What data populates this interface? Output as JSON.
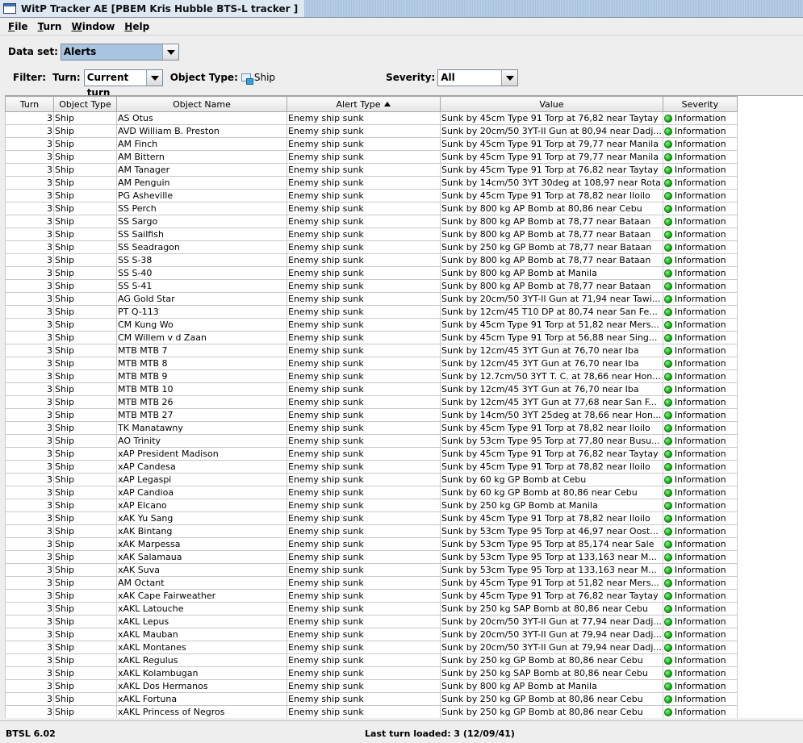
{
  "window": {
    "title": "WitP Tracker AE [PBEM Kris Hubble BTS-L  tracker ]"
  },
  "menu": [
    "File",
    "Turn",
    "Window",
    "Help"
  ],
  "dataset": {
    "label": "Data set:",
    "value": "Alerts"
  },
  "filter": {
    "label": "Filter:",
    "turn_label": "Turn:",
    "turn_value": "Current turn",
    "object_type_label": "Object Type:",
    "object_type_value": "Ship",
    "severity_label": "Severity:",
    "severity_value": "All"
  },
  "table": {
    "columns": [
      "Turn",
      "Object Type",
      "Object Name",
      "Alert Type",
      "Value",
      "Severity"
    ],
    "rows": [
      [
        "3",
        "Ship",
        "AS Otus",
        "Enemy ship sunk",
        "Sunk by 45cm Type 91 Torp at 76,82 near Taytay",
        "Information"
      ],
      [
        "3",
        "Ship",
        "AVD William B. Preston",
        "Enemy ship sunk",
        "Sunk by 20cm/50 3YT-II Gun at 80,94 near Dadj...",
        "Information"
      ],
      [
        "3",
        "Ship",
        "AM Finch",
        "Enemy ship sunk",
        "Sunk by 45cm Type 91 Torp at 79,77 near Manila",
        "Information"
      ],
      [
        "3",
        "Ship",
        "AM Bittern",
        "Enemy ship sunk",
        "Sunk by 45cm Type 91 Torp at 79,77 near Manila",
        "Information"
      ],
      [
        "3",
        "Ship",
        "AM Tanager",
        "Enemy ship sunk",
        "Sunk by 45cm Type 91 Torp at 76,82 near Taytay",
        "Information"
      ],
      [
        "3",
        "Ship",
        "AM Penguin",
        "Enemy ship sunk",
        "Sunk by 14cm/50 3YT 30deg at 108,97 near Rota",
        "Information"
      ],
      [
        "3",
        "Ship",
        "PG Asheville",
        "Enemy ship sunk",
        "Sunk by 45cm Type 91 Torp at 78,82 near Iloilo",
        "Information"
      ],
      [
        "3",
        "Ship",
        "SS Perch",
        "Enemy ship sunk",
        "Sunk by 800 kg AP Bomb at 80,86 near Cebu",
        "Information"
      ],
      [
        "3",
        "Ship",
        "SS Sargo",
        "Enemy ship sunk",
        "Sunk by 800 kg AP Bomb at 78,77 near Bataan",
        "Information"
      ],
      [
        "3",
        "Ship",
        "SS Sailfish",
        "Enemy ship sunk",
        "Sunk by 800 kg AP Bomb at 78,77 near Bataan",
        "Information"
      ],
      [
        "3",
        "Ship",
        "SS Seadragon",
        "Enemy ship sunk",
        "Sunk by 250 kg GP Bomb at 78,77 near Bataan",
        "Information"
      ],
      [
        "3",
        "Ship",
        "SS S-38",
        "Enemy ship sunk",
        "Sunk by 800 kg AP Bomb at 78,77 near Bataan",
        "Information"
      ],
      [
        "3",
        "Ship",
        "SS S-40",
        "Enemy ship sunk",
        "Sunk by 800 kg AP Bomb at Manila",
        "Information"
      ],
      [
        "3",
        "Ship",
        "SS S-41",
        "Enemy ship sunk",
        "Sunk by 800 kg AP Bomb at 78,77 near Bataan",
        "Information"
      ],
      [
        "3",
        "Ship",
        "AG Gold Star",
        "Enemy ship sunk",
        "Sunk by 20cm/50 3YT-II Gun at 71,94 near Tawi...",
        "Information"
      ],
      [
        "3",
        "Ship",
        "PT Q-113",
        "Enemy ship sunk",
        "Sunk by 12cm/45 T10 DP at 80,74 near San Fe...",
        "Information"
      ],
      [
        "3",
        "Ship",
        "CM Kung Wo",
        "Enemy ship sunk",
        "Sunk by 45cm Type 91 Torp at 51,82 near Mers...",
        "Information"
      ],
      [
        "3",
        "Ship",
        "CM Willem v d Zaan",
        "Enemy ship sunk",
        "Sunk by 45cm Type 91 Torp at 56,88 near Sing...",
        "Information"
      ],
      [
        "3",
        "Ship",
        "MTB MTB 7",
        "Enemy ship sunk",
        "Sunk by 12cm/45 3YT Gun at 76,70 near Iba",
        "Information"
      ],
      [
        "3",
        "Ship",
        "MTB MTB 8",
        "Enemy ship sunk",
        "Sunk by 12cm/45 3YT Gun at 76,70 near Iba",
        "Information"
      ],
      [
        "3",
        "Ship",
        "MTB MTB 9",
        "Enemy ship sunk",
        "Sunk by 12.7cm/50 3YT T. C. at 78,66 near Hon...",
        "Information"
      ],
      [
        "3",
        "Ship",
        "MTB MTB 10",
        "Enemy ship sunk",
        "Sunk by 12cm/45 3YT Gun at 76,70 near Iba",
        "Information"
      ],
      [
        "3",
        "Ship",
        "MTB MTB 26",
        "Enemy ship sunk",
        "Sunk by 12cm/45 3YT Gun at 77,68 near San F...",
        "Information"
      ],
      [
        "3",
        "Ship",
        "MTB MTB 27",
        "Enemy ship sunk",
        "Sunk by 14cm/50 3YT 25deg at 78,66 near Hon...",
        "Information"
      ],
      [
        "3",
        "Ship",
        "TK Manatawny",
        "Enemy ship sunk",
        "Sunk by 45cm Type 91 Torp at 78,82 near Iloilo",
        "Information"
      ],
      [
        "3",
        "Ship",
        "AO Trinity",
        "Enemy ship sunk",
        "Sunk by 53cm Type 95 Torp at 77,80 near Busu...",
        "Information"
      ],
      [
        "3",
        "Ship",
        "xAP President Madison",
        "Enemy ship sunk",
        "Sunk by 45cm Type 91 Torp at 76,82 near Taytay",
        "Information"
      ],
      [
        "3",
        "Ship",
        "xAP Candesa",
        "Enemy ship sunk",
        "Sunk by 45cm Type 91 Torp at 78,82 near Iloilo",
        "Information"
      ],
      [
        "3",
        "Ship",
        "xAP Legaspi",
        "Enemy ship sunk",
        "Sunk by 60 kg GP Bomb at Cebu",
        "Information"
      ],
      [
        "3",
        "Ship",
        "xAP Candioa",
        "Enemy ship sunk",
        "Sunk by 60 kg GP Bomb at 80,86 near Cebu",
        "Information"
      ],
      [
        "3",
        "Ship",
        "xAP Elcano",
        "Enemy ship sunk",
        "Sunk by 250 kg GP Bomb at Manila",
        "Information"
      ],
      [
        "3",
        "Ship",
        "xAK Yu Sang",
        "Enemy ship sunk",
        "Sunk by 45cm Type 91 Torp at 78,82 near Iloilo",
        "Information"
      ],
      [
        "3",
        "Ship",
        "xAK Bintang",
        "Enemy ship sunk",
        "Sunk by 53cm Type 95 Torp at 46,97 near Oost...",
        "Information"
      ],
      [
        "3",
        "Ship",
        "xAK Marpessa",
        "Enemy ship sunk",
        "Sunk by 53cm Type 95 Torp at 85,174 near Sale",
        "Information"
      ],
      [
        "3",
        "Ship",
        "xAK Salamaua",
        "Enemy ship sunk",
        "Sunk by 53cm Type 95 Torp at 133,163 near M...",
        "Information"
      ],
      [
        "3",
        "Ship",
        "xAK Suva",
        "Enemy ship sunk",
        "Sunk by 53cm Type 95 Torp at 133,163 near M...",
        "Information"
      ],
      [
        "3",
        "Ship",
        "AM Octant",
        "Enemy ship sunk",
        "Sunk by 45cm Type 91 Torp at 51,82 near Mers...",
        "Information"
      ],
      [
        "3",
        "Ship",
        "xAK Cape Fairweather",
        "Enemy ship sunk",
        "Sunk by 45cm Type 91 Torp at 76,82 near Taytay",
        "Information"
      ],
      [
        "3",
        "Ship",
        "xAKL Latouche",
        "Enemy ship sunk",
        "Sunk by 250 kg SAP Bomb at 80,86 near Cebu",
        "Information"
      ],
      [
        "3",
        "Ship",
        "xAKL Lepus",
        "Enemy ship sunk",
        "Sunk by 20cm/50 3YT-II Gun at 77,94 near Dadj...",
        "Information"
      ],
      [
        "3",
        "Ship",
        "xAKL Mauban",
        "Enemy ship sunk",
        "Sunk by 20cm/50 3YT-II Gun at 79,94 near Dadj...",
        "Information"
      ],
      [
        "3",
        "Ship",
        "xAKL Montanes",
        "Enemy ship sunk",
        "Sunk by 20cm/50 3YT-II Gun at 79,94 near Dadj...",
        "Information"
      ],
      [
        "3",
        "Ship",
        "xAKL Regulus",
        "Enemy ship sunk",
        "Sunk by 250 kg GP Bomb at 80,86 near Cebu",
        "Information"
      ],
      [
        "3",
        "Ship",
        "xAKL Kolambugan",
        "Enemy ship sunk",
        "Sunk by 250 kg SAP Bomb at 80,86 near Cebu",
        "Information"
      ],
      [
        "3",
        "Ship",
        "xAKL Dos Hermanos",
        "Enemy ship sunk",
        "Sunk by 800 kg AP Bomb at Manila",
        "Information"
      ],
      [
        "3",
        "Ship",
        "xAKL Fortuna",
        "Enemy ship sunk",
        "Sunk by 250 kg GP Bomb at 80,86 near Cebu",
        "Information"
      ],
      [
        "3",
        "Ship",
        "xAKL Princess of Negros",
        "Enemy ship sunk",
        "Sunk by 250 kg GP Bomb at 80,86 near Cebu",
        "Information"
      ]
    ]
  },
  "status": {
    "left": "BTSL 6.02",
    "center": "Last turn loaded: 3 (12/09/41)"
  },
  "colors": {
    "info_dot": "#12b012",
    "title_bar": "#b8cfe5"
  },
  "icons": {
    "severity": "green-dot-icon",
    "object_type": "ship-icon",
    "sort": "sort-ascending-icon"
  }
}
